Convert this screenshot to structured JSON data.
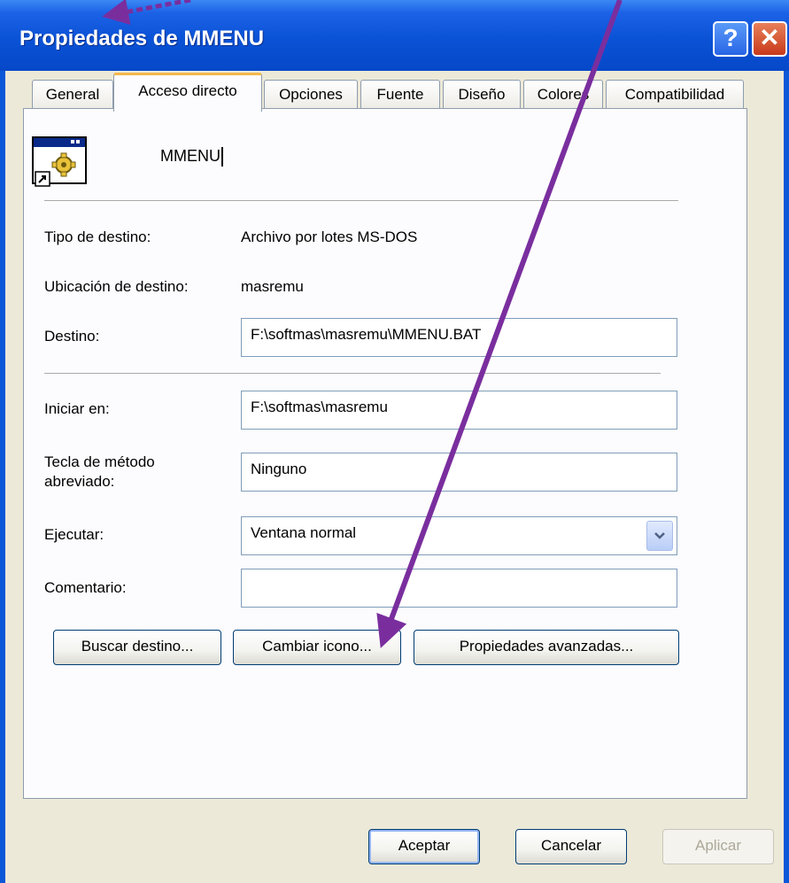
{
  "window": {
    "title": "Propiedades de MMENU",
    "help_glyph": "?",
    "close_glyph": "✕"
  },
  "tabs": [
    {
      "label": "General",
      "active": false
    },
    {
      "label": "Acceso directo",
      "active": true
    },
    {
      "label": "Opciones",
      "active": false
    },
    {
      "label": "Fuente",
      "active": false
    },
    {
      "label": "Diseño",
      "active": false
    },
    {
      "label": "Colores",
      "active": false
    },
    {
      "label": "Compatibilidad",
      "active": false
    }
  ],
  "shortcut": {
    "name": "MMENU",
    "target_type_label": "Tipo de destino:",
    "target_type_value": "Archivo por lotes MS-DOS",
    "target_location_label": "Ubicación de destino:",
    "target_location_value": "masremu",
    "target_label": "Destino:",
    "target_value": "F:\\softmas\\masremu\\MMENU.BAT",
    "start_in_label": "Iniciar en:",
    "start_in_value": "F:\\softmas\\masremu",
    "hotkey_label_line1": "Tecla de método",
    "hotkey_label_line2": "abreviado:",
    "hotkey_value": "Ninguno",
    "run_label": "Ejecutar:",
    "run_value": "Ventana normal",
    "comment_label": "Comentario:",
    "comment_value": ""
  },
  "buttons": {
    "find_target": "Buscar destino...",
    "change_icon": "Cambiar icono...",
    "advanced": "Propiedades avanzadas...",
    "ok": "Aceptar",
    "cancel": "Cancelar",
    "apply": "Aplicar"
  },
  "colors": {
    "titlebar": "#0a52d6",
    "annotation_arrow": "#7a2e9e"
  }
}
